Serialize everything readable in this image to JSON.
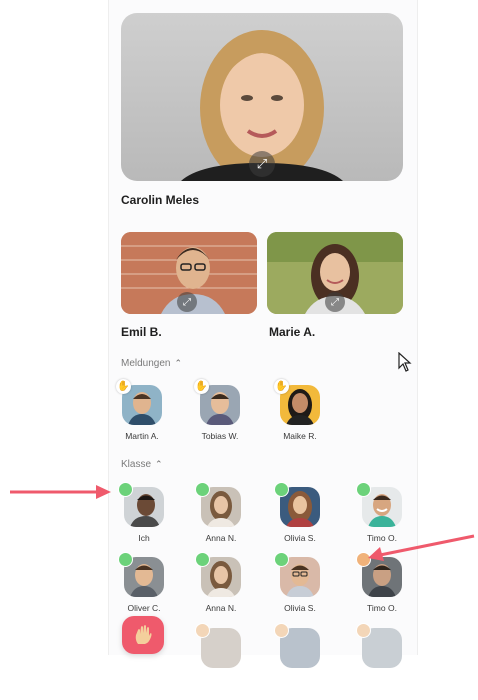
{
  "main_speaker": {
    "name": "Carolin Meles"
  },
  "spotlight": [
    {
      "name": "Emil B."
    },
    {
      "name": "Marie A."
    }
  ],
  "sections": {
    "meldungen": {
      "label": "Meldungen"
    },
    "klasse": {
      "label": "Klasse"
    }
  },
  "raised_hands": [
    {
      "name": "Martin A."
    },
    {
      "name": "Tobias W."
    },
    {
      "name": "Maike R."
    }
  ],
  "class_members": [
    {
      "name": "Ich",
      "status": "online"
    },
    {
      "name": "Anna N.",
      "status": "online"
    },
    {
      "name": "Olivia S.",
      "status": "online"
    },
    {
      "name": "Timo O.",
      "status": "online"
    },
    {
      "name": "Oliver C.",
      "status": "online"
    },
    {
      "name": "Anna N.",
      "status": "online"
    },
    {
      "name": "Olivia S.",
      "status": "online"
    },
    {
      "name": "Timo O.",
      "status": "away"
    }
  ],
  "colors": {
    "online": "#6cd27a",
    "away": "#f0b27a",
    "accent": "#ef5a6c",
    "arrow": "#ef5a6c"
  },
  "icons": {
    "fullscreen": "fullscreen-icon",
    "hand": "raised-hand-icon",
    "caret": "chevron-up-icon",
    "cursor": "mouse-pointer-icon"
  }
}
